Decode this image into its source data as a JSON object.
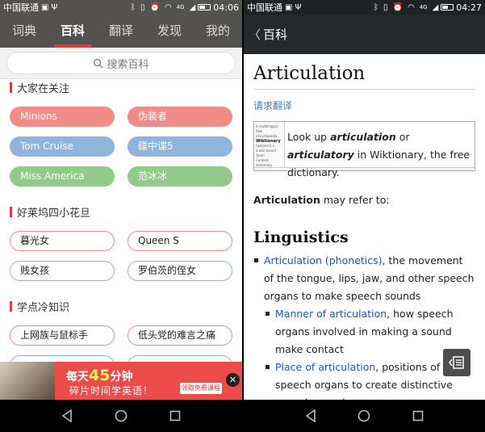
{
  "left": {
    "status": {
      "carrier": "中国联通",
      "time": "04:06",
      "network": "4G"
    },
    "tabs": [
      {
        "label": "词典",
        "active": false
      },
      {
        "label": "百科",
        "active": true
      },
      {
        "label": "翻译",
        "active": false
      },
      {
        "label": "发现",
        "active": false
      },
      {
        "label": "我的",
        "active": false
      }
    ],
    "search": {
      "placeholder": "搜索百科"
    },
    "sections": [
      {
        "title": "大家在关注",
        "items": [
          "Minions",
          "伪装者",
          "Tom Cruise",
          "碟中谍5",
          "Miss America",
          "范冰冰"
        ]
      },
      {
        "title": "好莱坞四小花旦",
        "items": [
          "暮光女",
          "Queen S",
          "贱女孩",
          "罗伯茨的侄女"
        ]
      },
      {
        "title": "学点冷知识",
        "items": [
          "上网族与鼠标手",
          "低头党的难言之痛"
        ]
      }
    ],
    "ad": {
      "line1_a": "每天",
      "line1_num": "45",
      "line1_b": "分钟",
      "line2": "碎片时间学英语！",
      "button": "领取免费课程",
      "close": "✕"
    },
    "colors": {
      "pink": "#f08c88",
      "blue": "#8fb5dc",
      "green": "#92ca8a",
      "accent": "#e23c3c"
    }
  },
  "right": {
    "status": {
      "carrier": "中国联通",
      "time": "04:27",
      "network": "4G"
    },
    "header": {
      "back": "〈",
      "title": "百科"
    },
    "article": {
      "title": "Articulation",
      "translate_link": "请求翻译",
      "wiktionary": {
        "logo_top": "A multilingual free encyclopedia",
        "logo_name": "Wiktionary",
        "logo_lines": [
          "[wɪkʃənri] n.",
          "a wiki-based Open",
          "Content dictionary"
        ],
        "pre": "Look up ",
        "word1": "articulation",
        "mid": " or ",
        "word2": "articulatory",
        "post": " in Wiktionary, the free dictionary."
      },
      "intro_bold": "Articulation",
      "intro_rest": " may refer to:",
      "h2": "Linguistics",
      "items": [
        {
          "link": "Articulation (phonetics)",
          "text": ", the movement of the tongue, lips, jaw, and other speech organs to make speech sounds",
          "sub": false
        },
        {
          "link": "Manner of articulation",
          "text": ", how speech organs involved in making a sound make contact",
          "sub": true
        },
        {
          "link": "Place of articulation",
          "text": ", positions of speech organs to create distinctive speech sounds",
          "sub": true
        }
      ]
    }
  }
}
